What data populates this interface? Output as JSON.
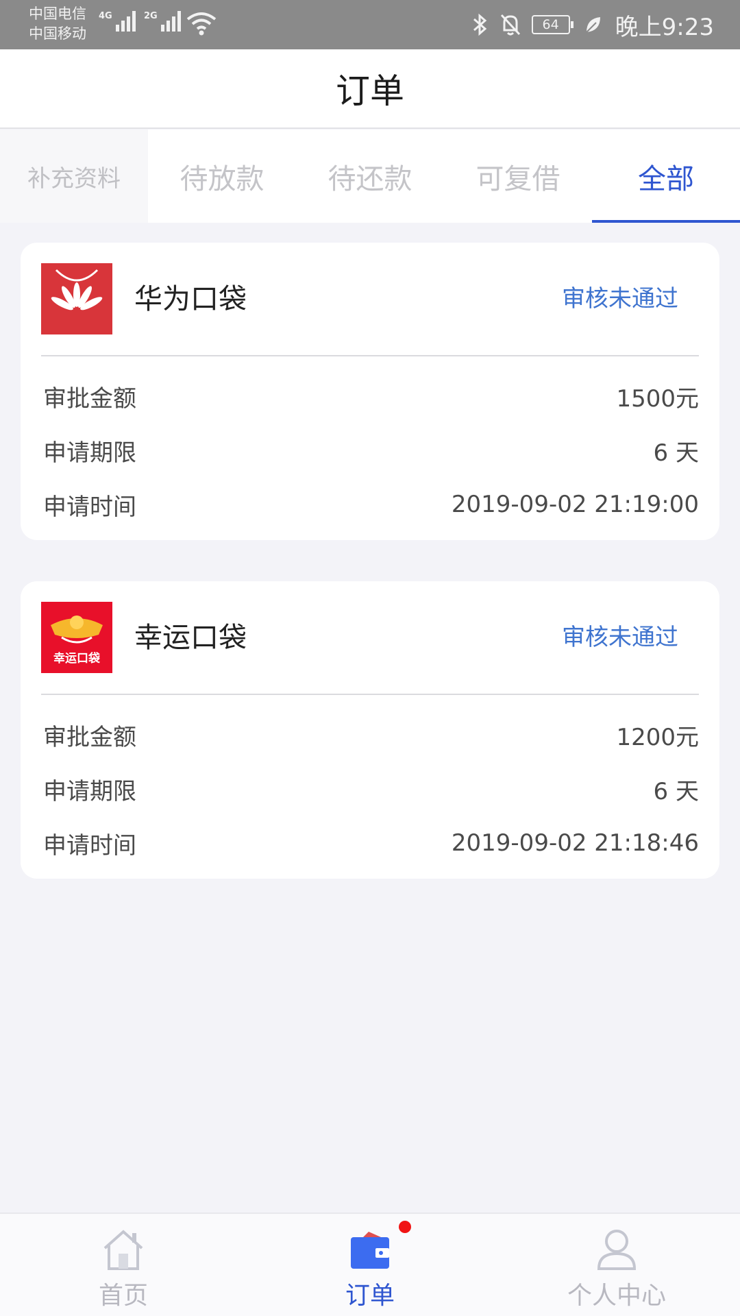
{
  "status_bar": {
    "carrier_1": "中国电信",
    "carrier_2": "中国移动",
    "net_1": "4G",
    "net_2": "2G",
    "battery": "64",
    "time": "晚上9:23"
  },
  "header": {
    "title": "订单"
  },
  "tabs": [
    {
      "label": "补充资料"
    },
    {
      "label": "待放款"
    },
    {
      "label": "待还款"
    },
    {
      "label": "可复借"
    },
    {
      "label": "全部",
      "active": true
    }
  ],
  "orders": [
    {
      "name": "华为口袋",
      "status": "审核未通过",
      "rows": [
        {
          "label": "审批金额",
          "value": "1500元"
        },
        {
          "label": "申请期限",
          "value": "6 天"
        },
        {
          "label": "申请时间",
          "value": "2019-09-02 21:19:00"
        }
      ]
    },
    {
      "name": "幸运口袋",
      "logo_text": "幸运口袋",
      "status": "审核未通过",
      "rows": [
        {
          "label": "审批金额",
          "value": "1200元"
        },
        {
          "label": "申请期限",
          "value": "6 天"
        },
        {
          "label": "申请时间",
          "value": "2019-09-02 21:18:46"
        }
      ]
    }
  ],
  "bottom_nav": [
    {
      "label": "首页",
      "icon": "home-icon"
    },
    {
      "label": "订单",
      "icon": "wallet-icon",
      "active": true
    },
    {
      "label": "个人中心",
      "icon": "user-icon"
    }
  ],
  "colors": {
    "accent": "#2f56d0",
    "status_text": "#3f74cf",
    "badge": "#f01414"
  }
}
